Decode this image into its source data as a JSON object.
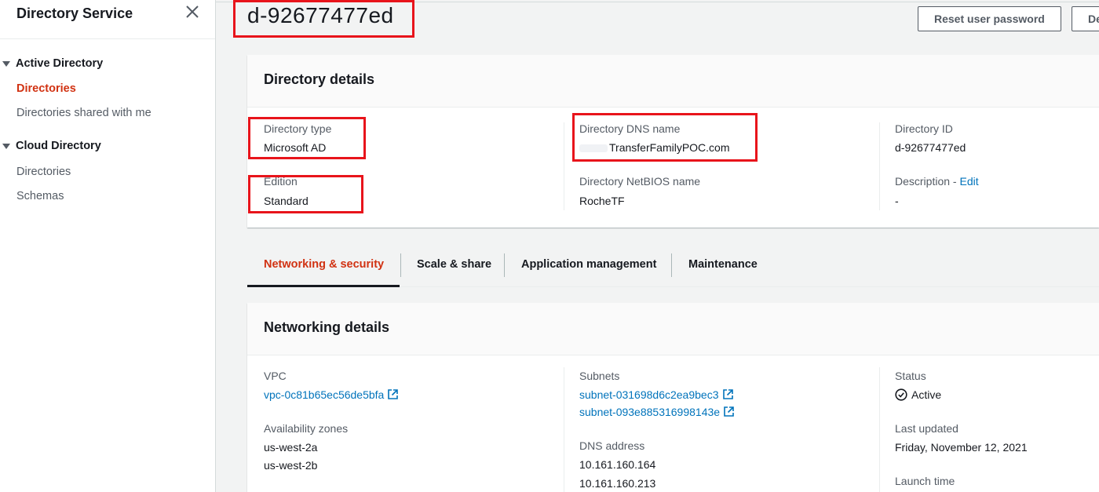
{
  "sidebar": {
    "title": "Directory Service",
    "sections": [
      {
        "label": "Active Directory",
        "items": [
          {
            "label": "Directories"
          },
          {
            "label": "Directories shared with me"
          }
        ]
      },
      {
        "label": "Cloud Directory",
        "items": [
          {
            "label": "Directories"
          },
          {
            "label": "Schemas"
          }
        ]
      }
    ]
  },
  "header": {
    "title": "d-92677477ed",
    "reset_password_label": "Reset user password",
    "second_button_label": "De"
  },
  "details": {
    "title": "Directory details",
    "directory_type": {
      "label": "Directory type",
      "value": "Microsoft AD"
    },
    "edition": {
      "label": "Edition",
      "value": "Standard"
    },
    "dns_name": {
      "label": "Directory DNS name",
      "value": "TransferFamilyPOC.com"
    },
    "netbios": {
      "label": "Directory NetBIOS name",
      "value": "RocheTF"
    },
    "directory_id": {
      "label": "Directory ID",
      "value": "d-92677477ed"
    },
    "description": {
      "label": "Description",
      "sep": " - ",
      "edit": "Edit",
      "value": "-"
    }
  },
  "tabs": [
    {
      "label": "Networking & security"
    },
    {
      "label": "Scale & share"
    },
    {
      "label": "Application management"
    },
    {
      "label": "Maintenance"
    }
  ],
  "networking": {
    "title": "Networking details",
    "vpc": {
      "label": "VPC",
      "value": "vpc-0c81b65ec56de5bfa"
    },
    "az": {
      "label": "Availability zones",
      "values": [
        "us-west-2a",
        "us-west-2b"
      ]
    },
    "subnets": {
      "label": "Subnets",
      "values": [
        "subnet-031698d6c2ea9bec3",
        "subnet-093e885316998143e"
      ]
    },
    "dns_address": {
      "label": "DNS address",
      "values": [
        "10.161.160.164",
        "10.161.160.213"
      ]
    },
    "status": {
      "label": "Status",
      "value": "Active"
    },
    "last_updated": {
      "label": "Last updated",
      "value": "Friday, November 12, 2021"
    },
    "launch_time": {
      "label": "Launch time"
    }
  },
  "colors": {
    "accent": "#d13212",
    "link": "#0073bb",
    "highlight_box": "#e8141b"
  }
}
